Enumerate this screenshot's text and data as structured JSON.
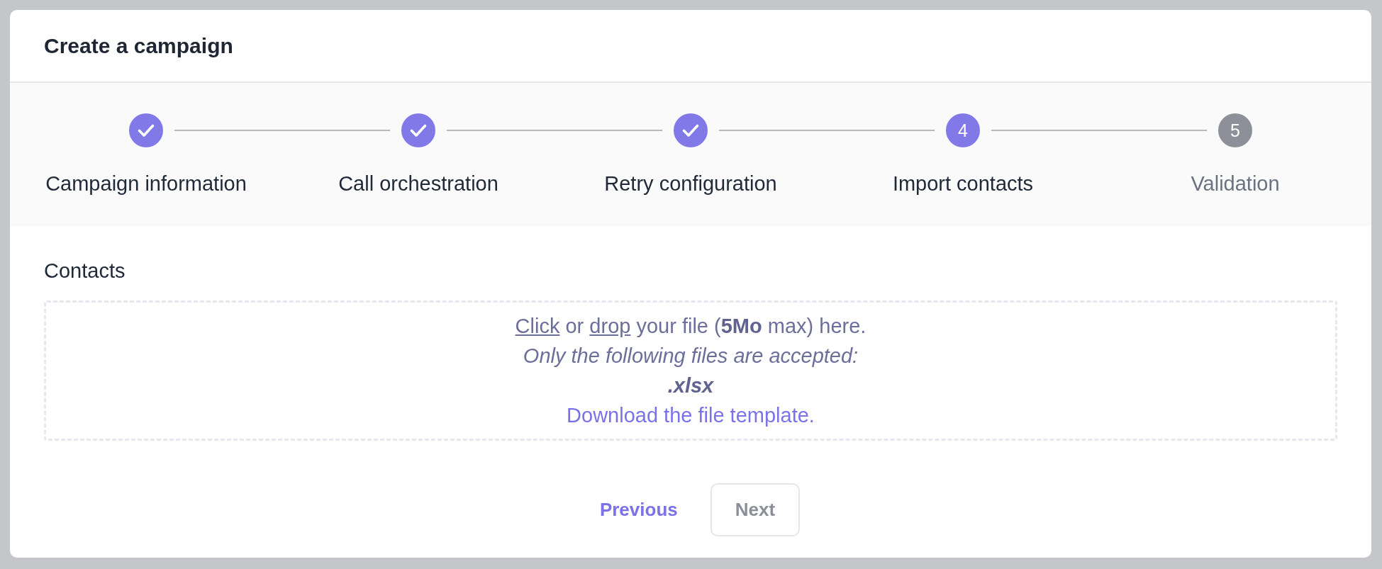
{
  "dialog": {
    "title": "Create a campaign"
  },
  "steps": [
    {
      "label": "Campaign information",
      "completed": true,
      "active": true
    },
    {
      "label": "Call orchestration",
      "completed": true,
      "active": true
    },
    {
      "label": "Retry configuration",
      "completed": true,
      "active": true
    },
    {
      "label": "Import contacts",
      "number": "4",
      "completed": false,
      "active": true
    },
    {
      "label": "Validation",
      "number": "5",
      "completed": false,
      "active": false
    }
  ],
  "upload": {
    "label": "Contacts",
    "prompt": [
      {
        "kind": "link",
        "text": "Click"
      },
      {
        "kind": "text",
        "text": " or "
      },
      {
        "kind": "link",
        "text": "drop"
      },
      {
        "kind": "text",
        "text": " your file (**5Mo** max) here."
      }
    ],
    "accepted_note": "Only the following files are accepted:",
    "accepted_formats": [
      ".xlsx"
    ],
    "template_link": "Download the file template."
  },
  "buttons": [
    {
      "label": "Previous",
      "kind": "link",
      "disabled": false
    },
    {
      "label": "Next",
      "kind": "outline",
      "disabled": true
    }
  ]
}
